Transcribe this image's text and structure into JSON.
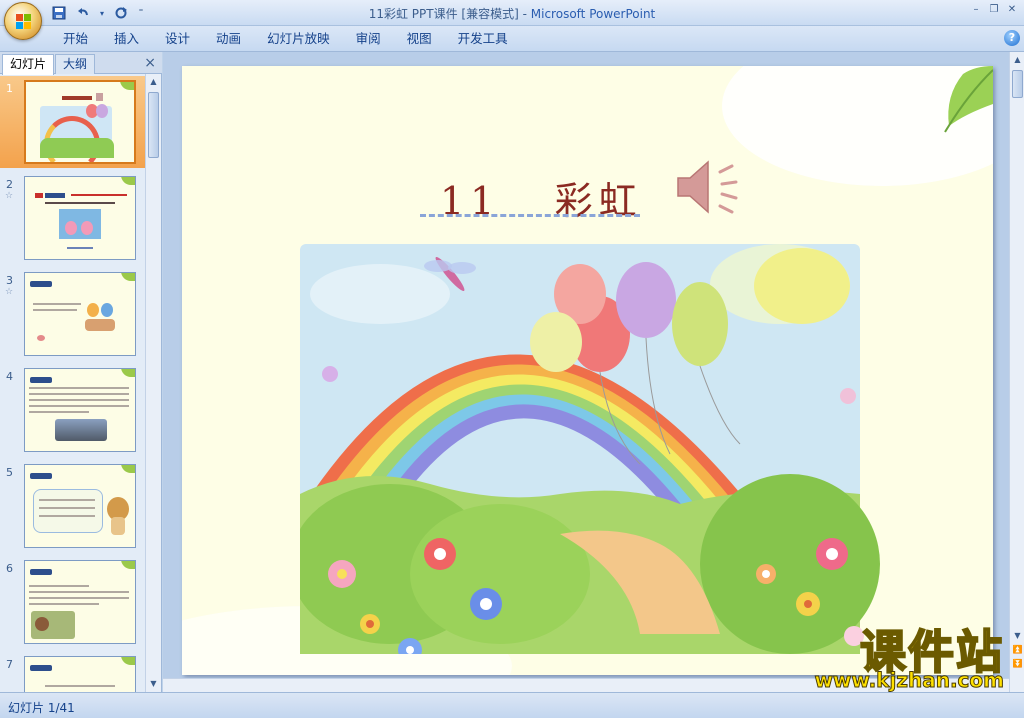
{
  "window": {
    "title_doc": "11彩虹  PPT课件 [兼容模式] -",
    "title_app": "Microsoft PowerPoint"
  },
  "qat": {
    "save_icon": "save-icon",
    "undo_icon": "undo-icon",
    "redo_icon": "redo-icon",
    "customize_icon": "customize-arrow-icon"
  },
  "ribbon": {
    "tabs": [
      "开始",
      "插入",
      "设计",
      "动画",
      "幻灯片放映",
      "审阅",
      "视图",
      "开发工具"
    ],
    "help_label": "?"
  },
  "pane": {
    "tab_slides": "幻灯片",
    "tab_outline": "大纲",
    "close_label": "×"
  },
  "thumbnails": [
    {
      "num": "1",
      "star": ""
    },
    {
      "num": "2",
      "star": "☆"
    },
    {
      "num": "3",
      "star": "☆"
    },
    {
      "num": "4",
      "star": ""
    },
    {
      "num": "5",
      "star": ""
    },
    {
      "num": "6",
      "star": ""
    },
    {
      "num": "7",
      "star": ""
    }
  ],
  "slide": {
    "title": "11   彩虹"
  },
  "watermark": {
    "cn": "课件站",
    "url": "www.kjzhan.com"
  },
  "status": {
    "slide_info": "幻灯片 1/41"
  },
  "colors": {
    "title_color": "#8b2a22",
    "selected_thumb": "#f3a24c",
    "ribbon_text": "#15428b"
  }
}
